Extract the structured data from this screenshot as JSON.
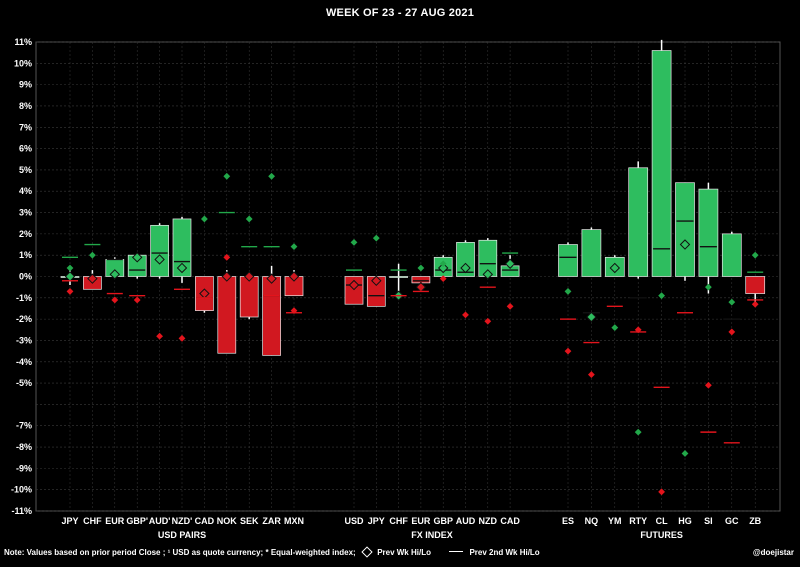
{
  "title": "WEEK OF  23 - 27 AUG 2021",
  "footer": {
    "note": "Note:  Values based on prior period Close ;",
    "usd_quote": " USD as quote  currency;",
    "eq_weight": " Equal-weighted  index;",
    "prev_wk": "Prev Wk Hi/Lo",
    "prev_2nd_wk": "Prev 2nd Wk Hi/Lo",
    "handle": "@doejistar"
  },
  "chart_data": {
    "type": "bar",
    "title": "WEEK OF  23 - 27 AUG 2021",
    "ylim": [
      -11,
      11
    ],
    "y_ticks": [
      11,
      10,
      9,
      8,
      7,
      6,
      5,
      4,
      3,
      2,
      1,
      0,
      -1,
      -2,
      -3,
      -4,
      -5,
      -7,
      -8,
      -9,
      -10,
      -11
    ],
    "y_tick_labels": [
      "11%",
      "10%",
      "9%",
      "8%",
      "7%",
      "6%",
      "5%",
      "4%",
      "3%",
      "2%",
      "1%",
      "0%",
      "-1%",
      "-2%",
      "-3%",
      "-4%",
      "-5%",
      "-7%",
      "-8%",
      "-9%",
      "-10%",
      "-11%"
    ],
    "grid": true,
    "colors": {
      "up": "#2ebd5f",
      "down": "#d11820",
      "up_marker": "#22a84a",
      "down_marker": "#e3141c",
      "grid": "#3a3a3a",
      "background": "#000000"
    },
    "groups": [
      {
        "label": "USD PAIRS",
        "categories": [
          "JPY",
          "CHF",
          "EUR",
          "GBP'",
          "AUD'",
          "NZD'",
          "CAD",
          "NOK",
          "SEK",
          "ZAR",
          "MXN"
        ]
      },
      {
        "label": "FX INDEX",
        "categories": [
          "USD",
          "JPY",
          "CHF",
          "EUR",
          "GBP",
          "AUD",
          "NZD",
          "CAD"
        ]
      },
      {
        "label": "FUTURES",
        "categories": [
          "ES",
          "NQ",
          "YM",
          "RTY",
          "CL",
          "HG",
          "SI",
          "GC",
          "ZB"
        ]
      }
    ],
    "series": [
      {
        "name": "USD PAIRS",
        "values": [
          0.0,
          -0.6,
          0.8,
          1.0,
          2.4,
          2.7,
          -1.6,
          -3.6,
          -1.9,
          -3.7,
          -0.9
        ],
        "high": [
          0.3,
          0.3,
          0.9,
          1.0,
          2.5,
          2.8,
          0.0,
          0.3,
          0.0,
          0.5,
          0.3
        ],
        "low": [
          -0.4,
          -0.6,
          -0.1,
          -0.1,
          -0.1,
          -0.3,
          -1.7,
          -3.6,
          -2.0,
          -3.7,
          -0.9
        ],
        "prev_wk_level": [
          0.0,
          -0.1,
          0.1,
          0.9,
          0.8,
          0.4,
          -0.8,
          0.0,
          0.0,
          -0.1,
          0.0
        ],
        "prev_wk_hi": [
          0.4,
          1.0,
          null,
          null,
          null,
          null,
          2.7,
          4.7,
          2.7,
          4.7,
          1.4
        ],
        "prev_wk_lo": [
          -0.7,
          null,
          -1.1,
          -1.1,
          -2.8,
          -2.9,
          null,
          0.9,
          null,
          null,
          -1.6
        ],
        "prev_2nd_wk_hi": [
          0.9,
          1.5,
          null,
          null,
          null,
          null,
          null,
          3.0,
          1.4,
          1.4,
          null
        ],
        "prev_2nd_wk_lo": [
          -0.2,
          null,
          -0.8,
          -0.9,
          null,
          -0.6,
          -1.0,
          null,
          null,
          -0.9,
          -1.7
        ],
        "inner_lines": [
          -0.2,
          null,
          0.8,
          0.3,
          1.1,
          0.7,
          -1.0,
          null,
          null,
          -0.9,
          null
        ]
      },
      {
        "name": "FX INDEX",
        "values": [
          -1.3,
          -1.4,
          0.0,
          -0.3,
          0.9,
          1.6,
          1.7,
          0.5
        ],
        "high": [
          0.0,
          0.0,
          0.6,
          0.0,
          1.0,
          1.7,
          1.8,
          1.0
        ],
        "low": [
          -1.3,
          -1.4,
          -0.9,
          -0.4,
          -0.1,
          0.0,
          0.0,
          0.0
        ],
        "prev_wk_level": [
          -0.4,
          -0.2,
          -0.9,
          -0.5,
          0.4,
          0.4,
          0.1,
          0.6
        ],
        "prev_wk_hi": [
          1.6,
          1.8,
          null,
          0.4,
          0.6,
          null,
          null,
          null
        ],
        "prev_wk_lo": [
          null,
          null,
          null,
          null,
          -0.1,
          -1.8,
          -2.1,
          -1.4
        ],
        "prev_2nd_wk_hi": [
          0.3,
          null,
          0.3,
          null,
          null,
          null,
          null,
          1.1
        ],
        "prev_2nd_wk_lo": [
          null,
          null,
          -0.9,
          -0.7,
          null,
          null,
          -0.5,
          null
        ],
        "inner_lines": [
          -0.4,
          -0.9,
          null,
          -0.2,
          0.3,
          0.2,
          0.6,
          0.3
        ]
      },
      {
        "name": "FUTURES",
        "values": [
          1.5,
          2.2,
          0.9,
          5.1,
          10.6,
          4.4,
          4.1,
          2.0,
          -0.8
        ],
        "high": [
          1.6,
          2.3,
          1.0,
          5.4,
          11.1,
          4.4,
          4.4,
          2.1,
          0.0
        ],
        "low": [
          0.0,
          0.0,
          0.0,
          -0.1,
          0.0,
          -0.2,
          -0.8,
          0.0,
          -1.4
        ],
        "prev_wk_level": [
          null,
          -1.9,
          0.4,
          null,
          null,
          1.5,
          null,
          null,
          null
        ],
        "prev_wk_hi": [
          null,
          null,
          null,
          null,
          null,
          null,
          null,
          null,
          1.0
        ],
        "prev_wk_lo": [
          -0.7,
          null,
          -2.4,
          -7.3,
          -0.9,
          -8.3,
          -0.5,
          -1.2,
          null
        ],
        "prev_wk_lo_red": [
          -3.5,
          -4.6,
          null,
          -2.5,
          -10.1,
          null,
          -5.1,
          -2.6,
          -1.3
        ],
        "prev_2nd_wk_hi": [
          null,
          null,
          null,
          null,
          null,
          null,
          null,
          null,
          0.2
        ],
        "prev_2nd_wk_lo": [
          -2.0,
          -3.1,
          -1.4,
          -2.6,
          -5.2,
          -1.7,
          -7.3,
          -7.8,
          -1.1
        ],
        "inner_lines": [
          0.9,
          -1.7,
          null,
          -1.0,
          1.3,
          2.6,
          1.4,
          -2.0,
          null
        ]
      }
    ]
  }
}
